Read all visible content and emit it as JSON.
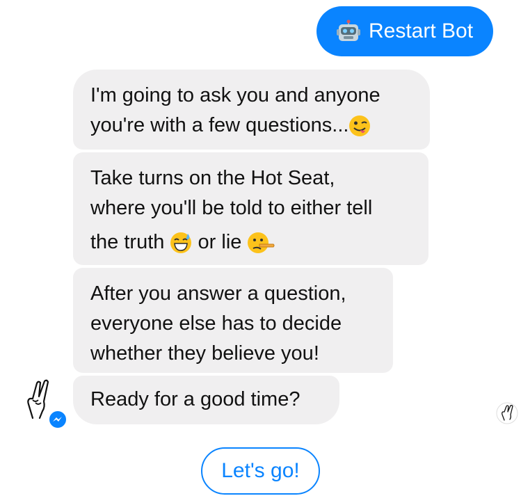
{
  "sent_message": {
    "emoji": "robot-face-icon",
    "text": "Restart Bot"
  },
  "bot_messages": [
    {
      "lines": [
        "I'm going to ask you and anyone",
        "you're with a few questions..."
      ]
    },
    {
      "lines": [
        "Take turns on the Hot Seat,",
        "where you'll be told to either tell",
        "the truth",
        "or lie"
      ]
    },
    {
      "lines": [
        "After you answer a question,",
        "everyone else has to decide",
        "whether they believe you!"
      ]
    },
    {
      "lines": [
        "Ready for a good time?"
      ]
    }
  ],
  "quick_reply": {
    "label": "Let's go!"
  },
  "colors": {
    "accent": "#0a84ff",
    "bubble": "#f0eff0"
  },
  "icons": [
    "robot-face-icon",
    "winking-tongue-emoji",
    "grinning-sweat-emoji",
    "lying-face-emoji",
    "crossed-fingers-avatar",
    "messenger-badge-icon",
    "seen-avatar"
  ]
}
